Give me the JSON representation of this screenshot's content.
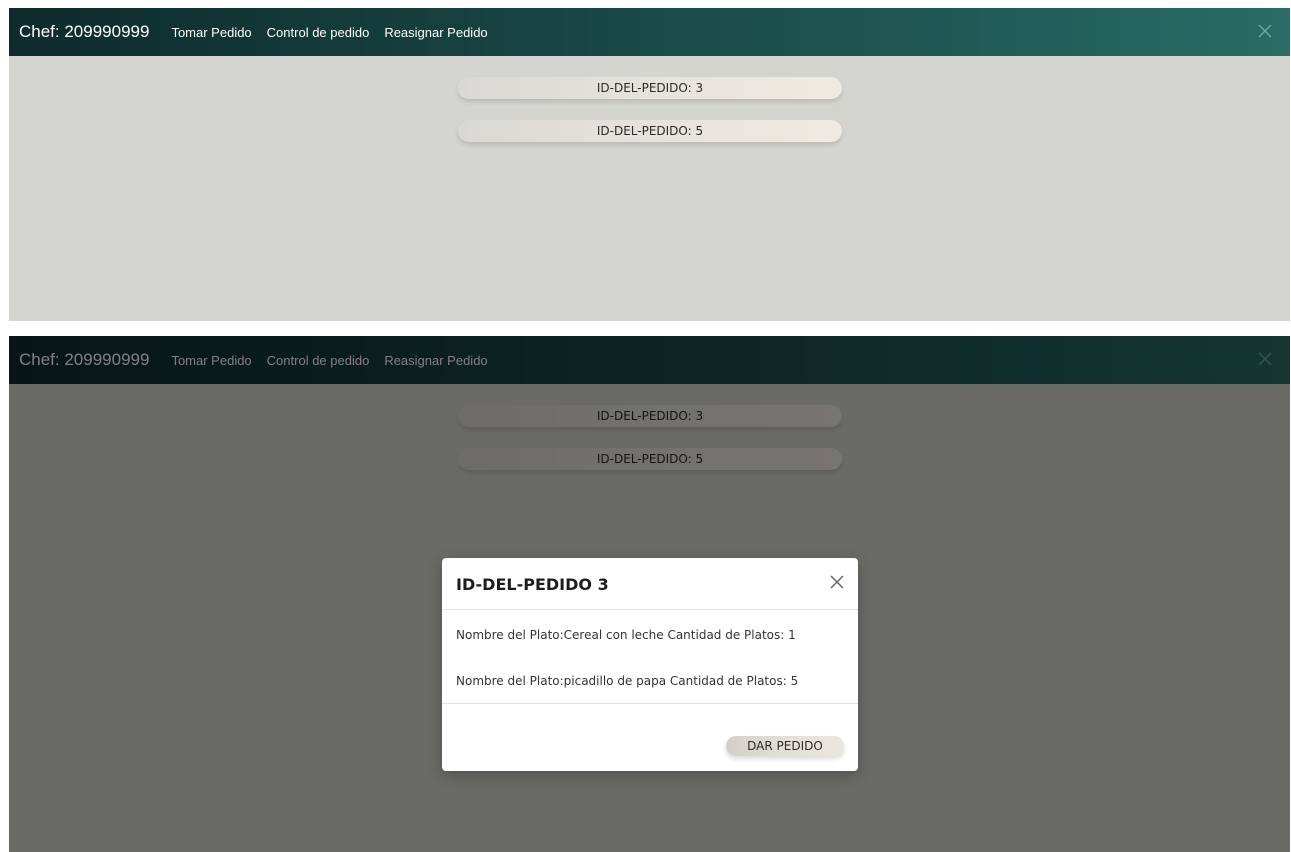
{
  "navbar": {
    "brand": "Chef: 209990999",
    "links": [
      "Tomar Pedido",
      "Control de pedido",
      "Reasignar Pedido"
    ],
    "close_icon": "close-icon"
  },
  "orders": [
    {
      "label": "ID-DEL-PEDIDO: 3"
    },
    {
      "label": "ID-DEL-PEDIDO: 5"
    }
  ],
  "modal": {
    "title": "ID-DEL-PEDIDO 3",
    "close_icon": "close-icon",
    "dishes": [
      {
        "text": "Nombre del Plato:Cereal con leche Cantidad de Platos: 1"
      },
      {
        "text": "Nombre del Plato:picadillo de papa Cantidad de Platos: 5"
      }
    ],
    "action_label": "DAR PEDIDO"
  },
  "colors": {
    "navbar_start": "#0e2a2d",
    "navbar_end": "#2a6c66",
    "background": "#d5d5cf",
    "overlay": "rgba(0,0,0,0.5)"
  }
}
